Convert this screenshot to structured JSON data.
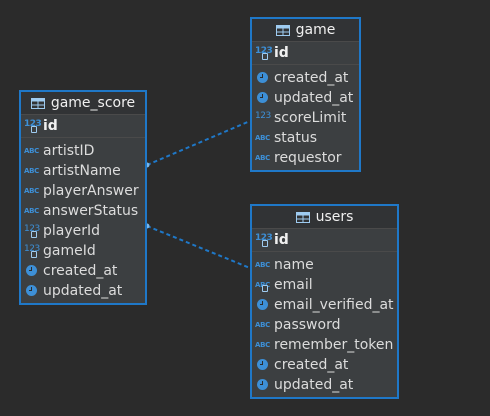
{
  "entities": {
    "game": {
      "name": "game",
      "pk": "id",
      "columns": [
        {
          "name": "created_at",
          "type_icon": "timestamp-icon"
        },
        {
          "name": "updated_at",
          "type_icon": "timestamp-icon"
        },
        {
          "name": "scoreLimit",
          "type_icon": "numeric-type-icon"
        },
        {
          "name": "status",
          "type_icon": "text-type-icon"
        },
        {
          "name": "requestor",
          "type_icon": "text-type-icon"
        }
      ]
    },
    "game_score": {
      "name": "game_score",
      "pk": "id",
      "columns": [
        {
          "name": "artistID",
          "type_icon": "text-type-icon"
        },
        {
          "name": "artistName",
          "type_icon": "text-type-icon"
        },
        {
          "name": "playerAnswer",
          "type_icon": "text-type-icon"
        },
        {
          "name": "answerStatus",
          "type_icon": "text-type-icon"
        },
        {
          "name": "playerId",
          "type_icon": "numeric-key-icon"
        },
        {
          "name": "gameId",
          "type_icon": "numeric-key-icon"
        },
        {
          "name": "created_at",
          "type_icon": "timestamp-icon"
        },
        {
          "name": "updated_at",
          "type_icon": "timestamp-icon"
        }
      ]
    },
    "users": {
      "name": "users",
      "pk": "id",
      "columns": [
        {
          "name": "name",
          "type_icon": "text-type-icon"
        },
        {
          "name": "email",
          "type_icon": "text-key-icon"
        },
        {
          "name": "email_verified_at",
          "type_icon": "timestamp-icon"
        },
        {
          "name": "password",
          "type_icon": "text-type-icon"
        },
        {
          "name": "remember_token",
          "type_icon": "text-type-icon"
        },
        {
          "name": "created_at",
          "type_icon": "timestamp-icon"
        },
        {
          "name": "updated_at",
          "type_icon": "timestamp-icon"
        }
      ]
    }
  },
  "type_labels": {
    "text": "ABC",
    "numeric": "123"
  },
  "colors": {
    "background": "#2b2b2b",
    "entity_border": "#1f78c8",
    "relation_line": "#1f78c8",
    "type_icon": "#3d8fd6"
  }
}
